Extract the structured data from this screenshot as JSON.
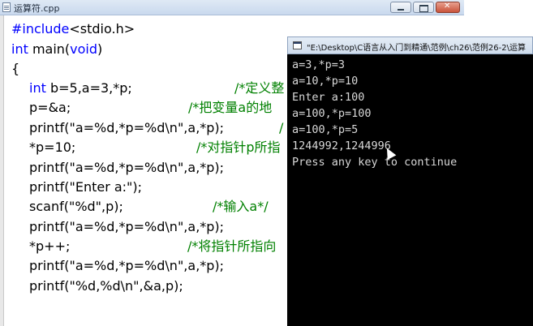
{
  "editor": {
    "title": "运算符.cpp",
    "code_lines": [
      {
        "parts": [
          {
            "t": "#include",
            "c": "kw"
          },
          {
            "t": "<stdio.h>",
            "c": ""
          }
        ]
      },
      {
        "parts": [
          {
            "t": "int",
            "c": "kw"
          },
          {
            "t": " main(",
            "c": ""
          },
          {
            "t": "void",
            "c": "kw"
          },
          {
            "t": ")",
            "c": ""
          }
        ]
      },
      {
        "parts": [
          {
            "t": "{",
            "c": ""
          }
        ]
      },
      {
        "parts": [
          {
            "t": "int",
            "c": "kw"
          },
          {
            "t": " b=5,a=3,*p;",
            "c": ""
          }
        ],
        "comment": "/*定义整"
      },
      {
        "parts": [
          {
            "t": "p=&a;",
            "c": ""
          }
        ],
        "comment": "/*把变量a的地"
      },
      {
        "parts": [
          {
            "t": "printf(\"a=%d,*p=%d\\n\",a,*p);",
            "c": ""
          }
        ],
        "comment": "/"
      },
      {
        "parts": [
          {
            "t": "*p=10;",
            "c": ""
          }
        ],
        "comment": "/*对指针p所指"
      },
      {
        "parts": [
          {
            "t": "printf(\"a=%d,*p=%d\\n\",a,*p);",
            "c": ""
          }
        ]
      },
      {
        "parts": [
          {
            "t": "printf(\"Enter a:\");",
            "c": ""
          }
        ]
      },
      {
        "parts": [
          {
            "t": "scanf(\"%d\",p);",
            "c": ""
          }
        ],
        "comment": "/*输入a*/"
      },
      {
        "parts": [
          {
            "t": "printf(\"a=%d,*p=%d\\n\",a,*p);",
            "c": ""
          }
        ]
      },
      {
        "parts": [
          {
            "t": "*p++;",
            "c": ""
          }
        ],
        "comment": "/*将指针所指向"
      },
      {
        "parts": [
          {
            "t": "printf(\"a=%d,*p=%d\\n\",a,*p);",
            "c": ""
          }
        ]
      },
      {
        "parts": [
          {
            "t": "printf(\"%d,%d\\n\",&a,p);",
            "c": ""
          }
        ]
      }
    ]
  },
  "console": {
    "title": "\"E:\\Desktop\\C语言从入门到精通\\范例\\ch26\\范例26-2\\运算",
    "lines": [
      "a=3,*p=3",
      "a=10,*p=10",
      "Enter a:100",
      "a=100,*p=100",
      "a=100,*p=5",
      "1244992,1244996",
      "Press any key to continue"
    ]
  }
}
